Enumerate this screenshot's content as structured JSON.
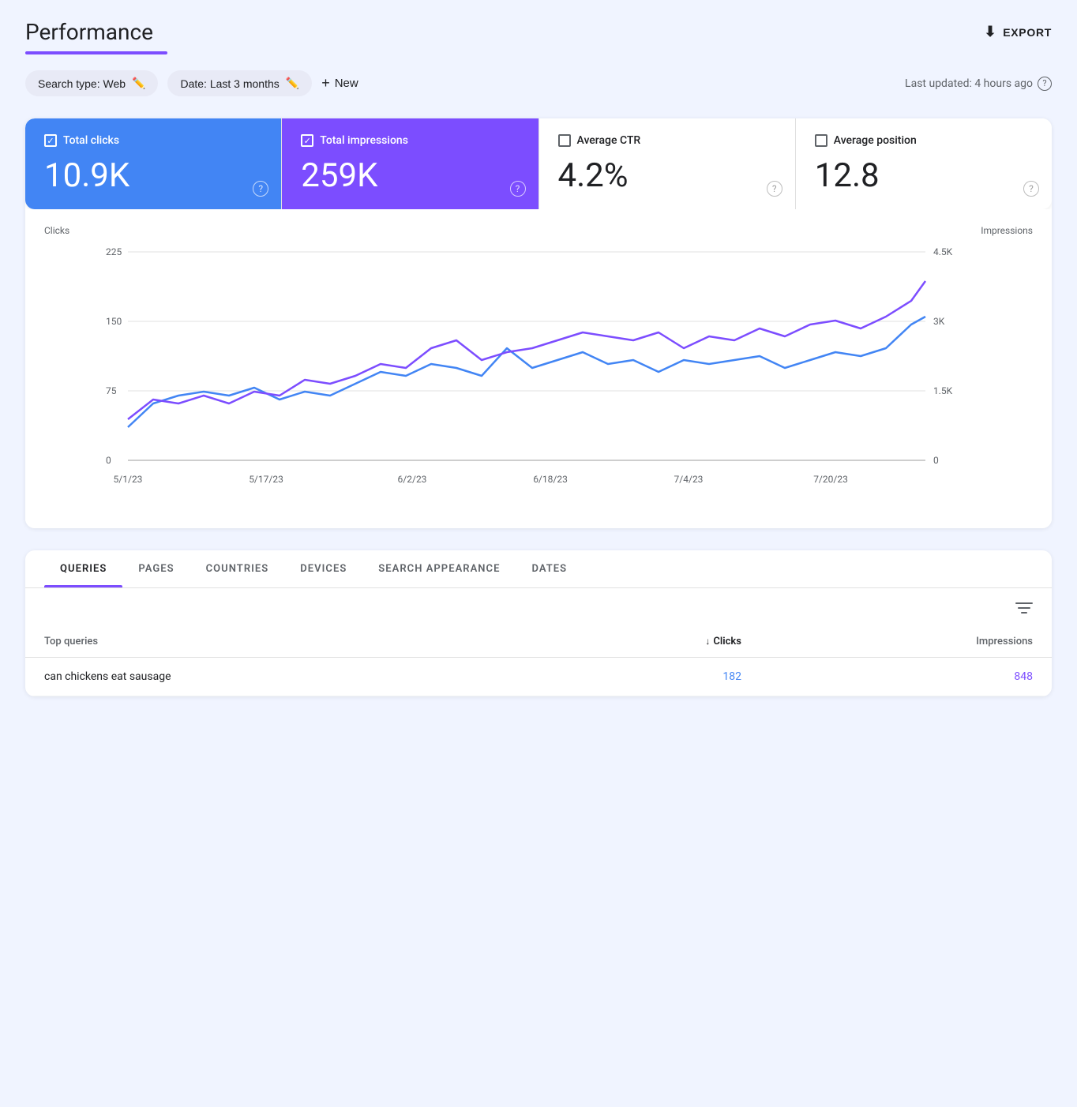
{
  "page": {
    "title": "Performance",
    "export_label": "EXPORT"
  },
  "filters": {
    "search_type_label": "Search type: Web",
    "date_label": "Date: Last 3 months",
    "new_label": "New",
    "last_updated": "Last updated: 4 hours ago"
  },
  "metrics": [
    {
      "id": "total_clicks",
      "label": "Total clicks",
      "value": "10.9K",
      "checked": true,
      "style": "active-blue"
    },
    {
      "id": "total_impressions",
      "label": "Total impressions",
      "value": "259K",
      "checked": true,
      "style": "active-purple"
    },
    {
      "id": "average_ctr",
      "label": "Average CTR",
      "value": "4.2%",
      "checked": false,
      "style": "inactive"
    },
    {
      "id": "average_position",
      "label": "Average position",
      "value": "12.8",
      "checked": false,
      "style": "inactive"
    }
  ],
  "chart": {
    "y_left_label": "Clicks",
    "y_right_label": "Impressions",
    "y_left_ticks": [
      "225",
      "150",
      "75",
      "0"
    ],
    "y_right_ticks": [
      "4.5K",
      "3K",
      "1.5K",
      "0"
    ],
    "x_labels": [
      "5/1/23",
      "5/17/23",
      "6/2/23",
      "6/18/23",
      "7/4/23",
      "7/20/23"
    ]
  },
  "tabs": [
    {
      "id": "queries",
      "label": "QUERIES",
      "active": true
    },
    {
      "id": "pages",
      "label": "PAGES",
      "active": false
    },
    {
      "id": "countries",
      "label": "COUNTRIES",
      "active": false
    },
    {
      "id": "devices",
      "label": "DEVICES",
      "active": false
    },
    {
      "id": "search_appearance",
      "label": "SEARCH APPEARANCE",
      "active": false
    },
    {
      "id": "dates",
      "label": "DATES",
      "active": false
    }
  ],
  "table": {
    "col_query": "Top queries",
    "col_clicks": "Clicks",
    "col_impressions": "Impressions",
    "rows": [
      {
        "query": "can chickens eat sausage",
        "clicks": "182",
        "impressions": "848"
      }
    ]
  }
}
